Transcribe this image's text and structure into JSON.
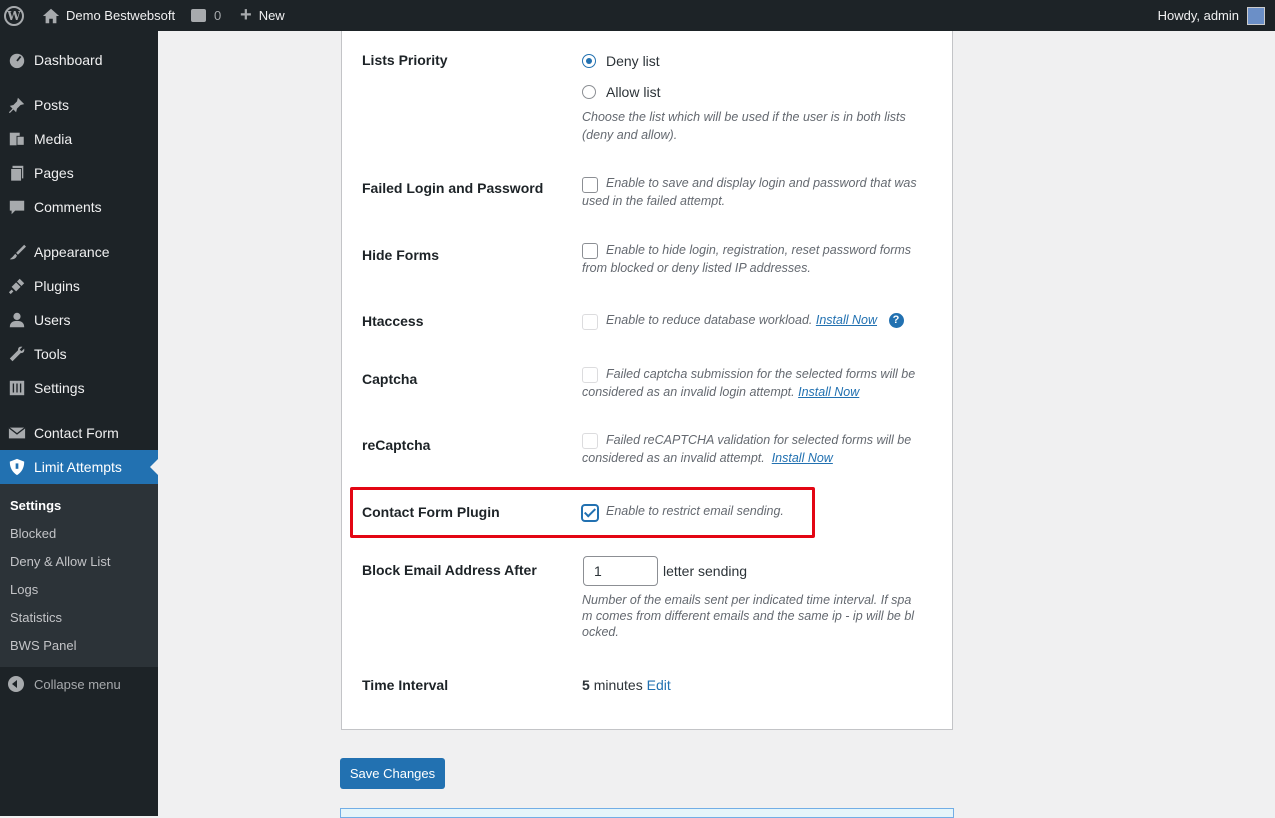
{
  "adminbar": {
    "site_name": "Demo Bestwebsoft",
    "comments_count": "0",
    "new_label": "New",
    "howdy": "Howdy, admin"
  },
  "sidebar": {
    "items": [
      {
        "label": "Dashboard",
        "icon": "dashboard-icon"
      },
      {
        "label": "Posts",
        "icon": "pin-icon"
      },
      {
        "label": "Media",
        "icon": "media-icon"
      },
      {
        "label": "Pages",
        "icon": "pages-icon"
      },
      {
        "label": "Comments",
        "icon": "comments-icon"
      },
      {
        "label": "Appearance",
        "icon": "brush-icon"
      },
      {
        "label": "Plugins",
        "icon": "plug-icon"
      },
      {
        "label": "Users",
        "icon": "user-icon"
      },
      {
        "label": "Tools",
        "icon": "wrench-icon"
      },
      {
        "label": "Settings",
        "icon": "sliders-icon"
      },
      {
        "label": "Contact Form",
        "icon": "envelope-icon"
      },
      {
        "label": "Limit Attempts",
        "icon": "shield-icon"
      }
    ],
    "submenu": [
      "Settings",
      "Blocked",
      "Deny & Allow List",
      "Logs",
      "Statistics",
      "BWS Panel"
    ],
    "collapse_label": "Collapse menu"
  },
  "settings": {
    "lists_priority": {
      "label": "Lists Priority",
      "option_deny": "Deny list",
      "option_allow": "Allow list",
      "selected": "Deny list",
      "desc_line1": "Choose the list which will be used if the user is in both lists",
      "desc_line2": "(deny and allow)."
    },
    "failed_login": {
      "label": "Failed Login and Password",
      "desc_line1": "Enable to save and display login and password that was",
      "desc_line2": "used in the failed attempt."
    },
    "hide_forms": {
      "label": "Hide Forms",
      "desc_line1": "Enable to hide login, registration, reset password forms",
      "desc_line2": "from blocked or deny listed IP addresses."
    },
    "htaccess": {
      "label": "Htaccess",
      "desc": "Enable to reduce database workload.",
      "link": "Install Now",
      "help": "?"
    },
    "captcha": {
      "label": "Captcha",
      "desc_line1": "Failed captcha submission for the selected forms will be",
      "desc_line2": "considered as an invalid login attempt.",
      "link": "Install Now"
    },
    "recaptcha": {
      "label": "reCaptcha",
      "desc_line1": "Failed reCAPTCHA validation for selected forms will be",
      "desc_line2": "considered as an invalid attempt.",
      "link": "Install Now"
    },
    "contact_form": {
      "label": "Contact Form Plugin",
      "desc": "Enable to restrict email sending.",
      "checked": true
    },
    "block_email": {
      "label": "Block Email Address After",
      "value": "1",
      "suffix": "letter sending",
      "desc_line1": "Number of the emails sent per indicated time interval. If spa",
      "desc_line2": "m comes from different emails and the same ip - ip will be bl",
      "desc_line3": "ocked."
    },
    "time_interval": {
      "label": "Time Interval",
      "value": "5",
      "unit": "minutes",
      "edit": "Edit"
    }
  },
  "save_button": "Save Changes",
  "colors": {
    "admin_dark": "#1d2327",
    "accent": "#2271b1",
    "highlight": "#e30613"
  }
}
